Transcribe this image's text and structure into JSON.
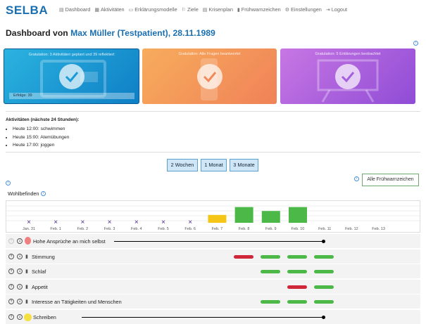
{
  "nav": {
    "logo": "SELBA",
    "items": [
      {
        "label": "Dashboard",
        "icon": "document-icon"
      },
      {
        "label": "Aktivitäten",
        "icon": "calendar-icon"
      },
      {
        "label": "Erklärungsmodelle",
        "icon": "chat-icon"
      },
      {
        "label": "Ziele",
        "icon": "flag-icon"
      },
      {
        "label": "Krisenplan",
        "icon": "document-icon"
      },
      {
        "label": "Frühwarnzeichen",
        "icon": "thermometer-icon"
      },
      {
        "label": "Einstellungen",
        "icon": "gear-icon"
      },
      {
        "label": "Logout",
        "icon": "logout-icon"
      }
    ]
  },
  "title": {
    "prefix": "Dashboard von",
    "patient": "Max Müller (Testpatient), 28.11.1989"
  },
  "cards": [
    {
      "caption": "Gratulation: 3 Aktivitäten geplant und 39 reflektiert",
      "badge": "Erfolge: 39",
      "color": "#1a9ad6"
    },
    {
      "caption": "Gratulation: Alle Fragen beantwortet",
      "color": "#f39a5a"
    },
    {
      "caption": "Gratulation: 5 Erklärungen beobachtet",
      "color": "#ad63de"
    }
  ],
  "activities": {
    "title": "Aktivitäten (nächste 24 Stunden):",
    "items": [
      "Heute 12:00: schwimmen",
      "Heute 15:00: Atemübungen",
      "Heute 17:00: joggen"
    ]
  },
  "range_buttons": [
    "2 Wochen",
    "1 Monat",
    "3 Monate"
  ],
  "warning_button": "Alle Frühwarnzeichen",
  "wellbeing_title": "Wohlbefinden",
  "chart_data": {
    "type": "bar",
    "categories": [
      "Jan. 31",
      "Feb. 1",
      "Feb. 2",
      "Feb. 3",
      "Feb. 4",
      "Feb. 5",
      "Feb. 6",
      "Feb. 7",
      "Feb. 8",
      "Feb. 9",
      "Feb. 10",
      "Feb. 11",
      "Feb. 12",
      "Feb. 13"
    ],
    "values": [
      null,
      null,
      null,
      null,
      null,
      null,
      null,
      2,
      4,
      3,
      4,
      null,
      null,
      null
    ],
    "colors": [
      "",
      "",
      "",
      "",
      "",
      "",
      "",
      "#f5c518",
      "#4cb848",
      "#4cb848",
      "#4cb848",
      "",
      "",
      ""
    ],
    "missing_marker": [
      true,
      true,
      true,
      true,
      true,
      true,
      true,
      false,
      false,
      false,
      false,
      false,
      false,
      false
    ],
    "ylim": [
      0,
      5
    ]
  },
  "rows": [
    {
      "label": "Hohe Ansprüche an mich selbst",
      "type": "line",
      "start": 8,
      "end": 11,
      "icon": "drop-icon"
    },
    {
      "label": "Stimmung",
      "type": "pills",
      "pills": [
        {
          "day": 8,
          "color": "r"
        },
        {
          "day": 9,
          "color": "g"
        },
        {
          "day": 10,
          "color": "g"
        },
        {
          "day": 11,
          "color": "g"
        }
      ]
    },
    {
      "label": "Schlaf",
      "type": "pills",
      "pills": [
        {
          "day": 9,
          "color": "g"
        },
        {
          "day": 10,
          "color": "g"
        },
        {
          "day": 11,
          "color": "g"
        }
      ]
    },
    {
      "label": "Appetit",
      "type": "pills",
      "pills": [
        {
          "day": 10,
          "color": "r"
        },
        {
          "day": 11,
          "color": "g"
        }
      ]
    },
    {
      "label": "Interesse an Tätigkeiten und Menschen",
      "type": "pills",
      "pills": [
        {
          "day": 9,
          "color": "g"
        },
        {
          "day": 10,
          "color": "g"
        },
        {
          "day": 11,
          "color": "g"
        }
      ]
    },
    {
      "label": "Schreiben",
      "type": "line",
      "start": 1,
      "end": 11,
      "icon": "sun-icon"
    }
  ]
}
